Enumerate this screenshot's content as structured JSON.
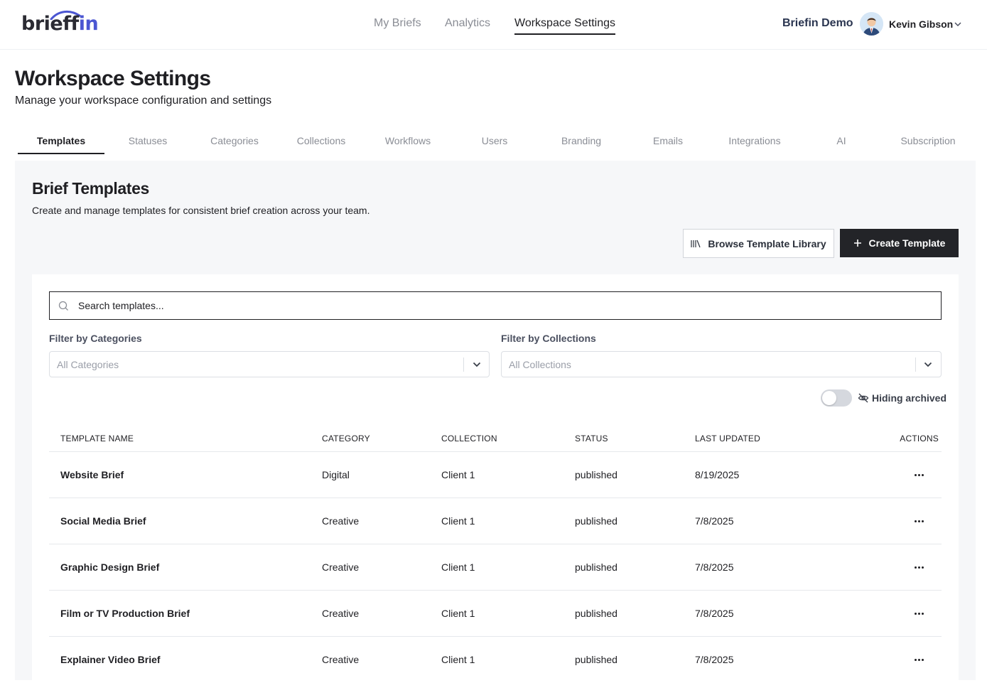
{
  "brand": {
    "logo_text_a": "brief",
    "logo_text_b": "in",
    "logo_text_f": "f"
  },
  "topnav": {
    "items": [
      {
        "label": "My Briefs",
        "active": false
      },
      {
        "label": "Analytics",
        "active": false
      },
      {
        "label": "Workspace Settings",
        "active": true
      }
    ]
  },
  "account": {
    "workspace_name": "Briefin Demo",
    "user_name": "Kevin Gibson"
  },
  "page": {
    "title": "Workspace Settings",
    "subtitle": "Manage your workspace configuration and settings"
  },
  "tabs": [
    {
      "label": "Templates",
      "active": true
    },
    {
      "label": "Statuses"
    },
    {
      "label": "Categories"
    },
    {
      "label": "Collections"
    },
    {
      "label": "Workflows"
    },
    {
      "label": "Users"
    },
    {
      "label": "Branding"
    },
    {
      "label": "Emails"
    },
    {
      "label": "Integrations"
    },
    {
      "label": "AI"
    },
    {
      "label": "Subscription"
    }
  ],
  "section": {
    "title": "Brief Templates",
    "description": "Create and manage templates for consistent brief creation across your team.",
    "browse_label": "Browse Template Library",
    "create_label": "Create Template"
  },
  "search": {
    "placeholder": "Search templates..."
  },
  "filters": {
    "categories_label": "Filter by Categories",
    "categories_value": "All Categories",
    "collections_label": "Filter by Collections",
    "collections_value": "All Collections"
  },
  "archived_toggle": {
    "label": "Hiding archived",
    "on": false
  },
  "table": {
    "headers": [
      "TEMPLATE NAME",
      "CATEGORY",
      "COLLECTION",
      "STATUS",
      "LAST UPDATED",
      "ACTIONS"
    ],
    "rows": [
      [
        "Website Brief",
        "Digital",
        "Client 1",
        "published",
        "8/19/2025"
      ],
      [
        "Social Media Brief",
        "Creative",
        "Client 1",
        "published",
        "7/8/2025"
      ],
      [
        "Graphic Design Brief",
        "Creative",
        "Client 1",
        "published",
        "7/8/2025"
      ],
      [
        "Film or TV Production Brief",
        "Creative",
        "Client 1",
        "published",
        "7/8/2025"
      ],
      [
        "Explainer Video Brief",
        "Creative",
        "Client 1",
        "published",
        "7/8/2025"
      ]
    ]
  },
  "colors": {
    "brand_blue": "#4b56d2",
    "dark": "#232428",
    "muted": "#8a8d95",
    "panel": "#f6f7f9"
  }
}
